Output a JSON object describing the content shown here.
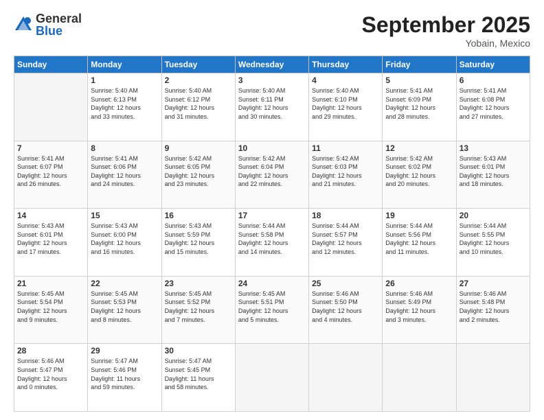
{
  "header": {
    "logo_general": "General",
    "logo_blue": "Blue",
    "title": "September 2025",
    "subtitle": "Yobain, Mexico"
  },
  "weekdays": [
    "Sunday",
    "Monday",
    "Tuesday",
    "Wednesday",
    "Thursday",
    "Friday",
    "Saturday"
  ],
  "weeks": [
    [
      {
        "day": "",
        "info": ""
      },
      {
        "day": "1",
        "info": "Sunrise: 5:40 AM\nSunset: 6:13 PM\nDaylight: 12 hours\nand 33 minutes."
      },
      {
        "day": "2",
        "info": "Sunrise: 5:40 AM\nSunset: 6:12 PM\nDaylight: 12 hours\nand 31 minutes."
      },
      {
        "day": "3",
        "info": "Sunrise: 5:40 AM\nSunset: 6:11 PM\nDaylight: 12 hours\nand 30 minutes."
      },
      {
        "day": "4",
        "info": "Sunrise: 5:40 AM\nSunset: 6:10 PM\nDaylight: 12 hours\nand 29 minutes."
      },
      {
        "day": "5",
        "info": "Sunrise: 5:41 AM\nSunset: 6:09 PM\nDaylight: 12 hours\nand 28 minutes."
      },
      {
        "day": "6",
        "info": "Sunrise: 5:41 AM\nSunset: 6:08 PM\nDaylight: 12 hours\nand 27 minutes."
      }
    ],
    [
      {
        "day": "7",
        "info": "Sunrise: 5:41 AM\nSunset: 6:07 PM\nDaylight: 12 hours\nand 26 minutes."
      },
      {
        "day": "8",
        "info": "Sunrise: 5:41 AM\nSunset: 6:06 PM\nDaylight: 12 hours\nand 24 minutes."
      },
      {
        "day": "9",
        "info": "Sunrise: 5:42 AM\nSunset: 6:05 PM\nDaylight: 12 hours\nand 23 minutes."
      },
      {
        "day": "10",
        "info": "Sunrise: 5:42 AM\nSunset: 6:04 PM\nDaylight: 12 hours\nand 22 minutes."
      },
      {
        "day": "11",
        "info": "Sunrise: 5:42 AM\nSunset: 6:03 PM\nDaylight: 12 hours\nand 21 minutes."
      },
      {
        "day": "12",
        "info": "Sunrise: 5:42 AM\nSunset: 6:02 PM\nDaylight: 12 hours\nand 20 minutes."
      },
      {
        "day": "13",
        "info": "Sunrise: 5:43 AM\nSunset: 6:01 PM\nDaylight: 12 hours\nand 18 minutes."
      }
    ],
    [
      {
        "day": "14",
        "info": "Sunrise: 5:43 AM\nSunset: 6:01 PM\nDaylight: 12 hours\nand 17 minutes."
      },
      {
        "day": "15",
        "info": "Sunrise: 5:43 AM\nSunset: 6:00 PM\nDaylight: 12 hours\nand 16 minutes."
      },
      {
        "day": "16",
        "info": "Sunrise: 5:43 AM\nSunset: 5:59 PM\nDaylight: 12 hours\nand 15 minutes."
      },
      {
        "day": "17",
        "info": "Sunrise: 5:44 AM\nSunset: 5:58 PM\nDaylight: 12 hours\nand 14 minutes."
      },
      {
        "day": "18",
        "info": "Sunrise: 5:44 AM\nSunset: 5:57 PM\nDaylight: 12 hours\nand 12 minutes."
      },
      {
        "day": "19",
        "info": "Sunrise: 5:44 AM\nSunset: 5:56 PM\nDaylight: 12 hours\nand 11 minutes."
      },
      {
        "day": "20",
        "info": "Sunrise: 5:44 AM\nSunset: 5:55 PM\nDaylight: 12 hours\nand 10 minutes."
      }
    ],
    [
      {
        "day": "21",
        "info": "Sunrise: 5:45 AM\nSunset: 5:54 PM\nDaylight: 12 hours\nand 9 minutes."
      },
      {
        "day": "22",
        "info": "Sunrise: 5:45 AM\nSunset: 5:53 PM\nDaylight: 12 hours\nand 8 minutes."
      },
      {
        "day": "23",
        "info": "Sunrise: 5:45 AM\nSunset: 5:52 PM\nDaylight: 12 hours\nand 7 minutes."
      },
      {
        "day": "24",
        "info": "Sunrise: 5:45 AM\nSunset: 5:51 PM\nDaylight: 12 hours\nand 5 minutes."
      },
      {
        "day": "25",
        "info": "Sunrise: 5:46 AM\nSunset: 5:50 PM\nDaylight: 12 hours\nand 4 minutes."
      },
      {
        "day": "26",
        "info": "Sunrise: 5:46 AM\nSunset: 5:49 PM\nDaylight: 12 hours\nand 3 minutes."
      },
      {
        "day": "27",
        "info": "Sunrise: 5:46 AM\nSunset: 5:48 PM\nDaylight: 12 hours\nand 2 minutes."
      }
    ],
    [
      {
        "day": "28",
        "info": "Sunrise: 5:46 AM\nSunset: 5:47 PM\nDaylight: 12 hours\nand 0 minutes."
      },
      {
        "day": "29",
        "info": "Sunrise: 5:47 AM\nSunset: 5:46 PM\nDaylight: 11 hours\nand 59 minutes."
      },
      {
        "day": "30",
        "info": "Sunrise: 5:47 AM\nSunset: 5:45 PM\nDaylight: 11 hours\nand 58 minutes."
      },
      {
        "day": "",
        "info": ""
      },
      {
        "day": "",
        "info": ""
      },
      {
        "day": "",
        "info": ""
      },
      {
        "day": "",
        "info": ""
      }
    ]
  ]
}
